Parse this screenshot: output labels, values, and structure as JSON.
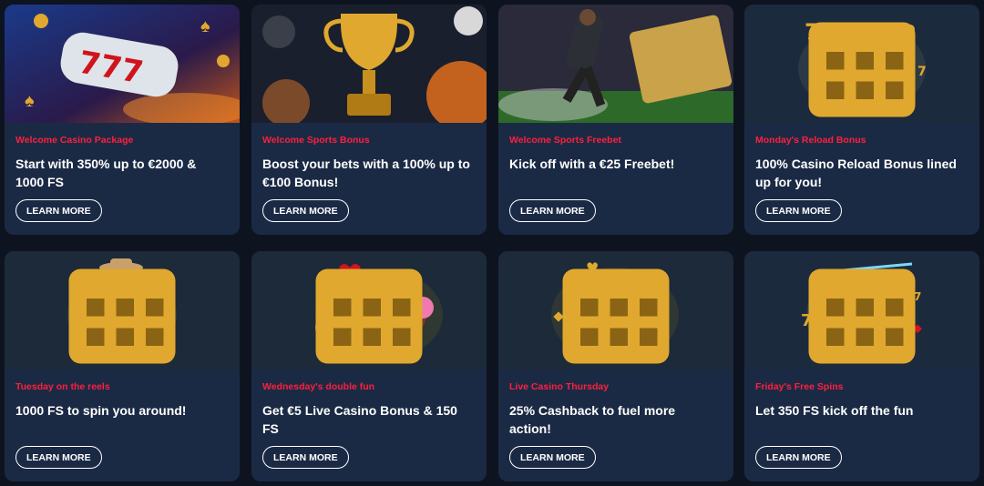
{
  "promos": [
    {
      "tag": "Welcome Casino Package",
      "headline": "Start with 350% up to €2000 & 1000 FS",
      "button": "LEARN MORE",
      "icon": "slot-777-icon"
    },
    {
      "tag": "Welcome Sports Bonus",
      "headline": "Boost your bets with a 100% up to €100 Bonus!",
      "button": "LEARN MORE",
      "icon": "trophy-icon"
    },
    {
      "tag": "Welcome Sports Freebet",
      "headline": "Kick off with a €25 Freebet!",
      "button": "LEARN MORE",
      "icon": "footballer-icon"
    },
    {
      "tag": "Monday's Reload Bonus",
      "headline": "100% Casino Reload Bonus lined up for you!",
      "button": "LEARN MORE",
      "icon": "slot-machine-icon"
    },
    {
      "tag": "Tuesday on the reels",
      "headline": "1000 FS to spin you around!",
      "button": "LEARN MORE",
      "icon": "cowboy-icon"
    },
    {
      "tag": "Wednesday's double fun",
      "headline": "Get €5 Live Casino Bonus & 150 FS",
      "button": "LEARN MORE",
      "icon": "roulette-icon"
    },
    {
      "tag": "Live Casino Thursday",
      "headline": "25% Cashback to fuel more action!",
      "button": "LEARN MORE",
      "icon": "poker-chip-icon"
    },
    {
      "tag": "Friday's Free Spins",
      "headline": "Let 350 FS kick off the fun",
      "button": "LEARN MORE",
      "icon": "zeus-icon"
    }
  ],
  "colors": {
    "card": "#1b2a44",
    "accent": "#ff1f3d",
    "gold": "#e0a82e"
  }
}
